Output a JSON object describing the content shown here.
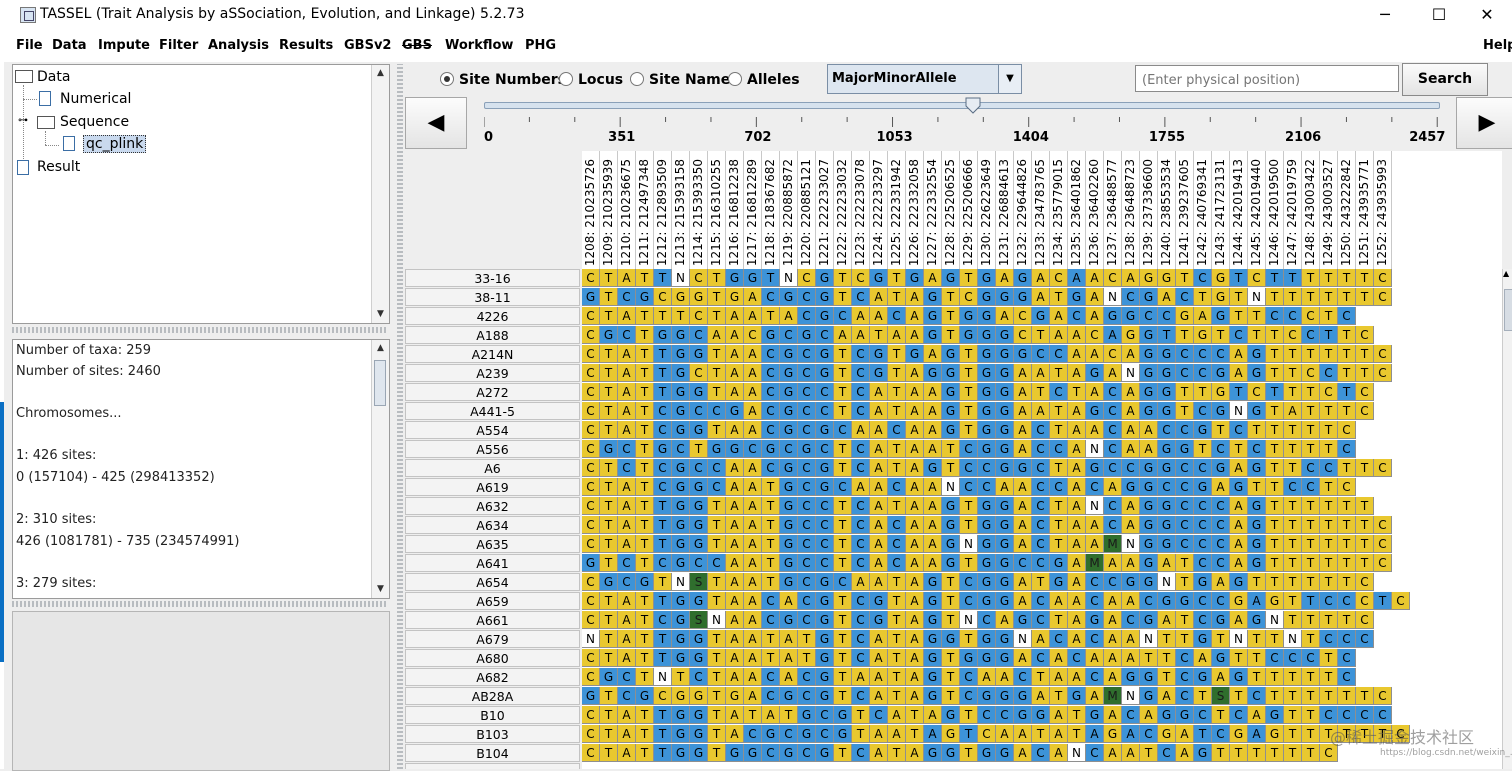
{
  "window": {
    "title": "TASSEL (Trait Analysis by aSSociation, Evolution, and Linkage) 5.2.73",
    "minimize": "─",
    "maximize": "☐",
    "close": "✕"
  },
  "menu": [
    "File",
    "Data",
    "Impute",
    "Filter",
    "Analysis",
    "Results",
    "GBSv2",
    "GBS",
    "Workflow",
    "PHG"
  ],
  "menu_help": "Help",
  "tree": {
    "root": "Data",
    "numerical": "Numerical",
    "sequence": "Sequence",
    "selected": "qc_plink",
    "result": "Result"
  },
  "info_lines": [
    "Number of taxa: 259",
    "Number of sites: 2460",
    "",
    "Chromosomes...",
    "",
    "1: 426 sites:",
    "0 (157104) - 425 (298413352)",
    "",
    "2: 310 sites:",
    "426 (1081781) - 735 (234574991)",
    "",
    "3: 279 sites:"
  ],
  "view_options": {
    "site_numbers": "Site Numbers",
    "locus": "Locus",
    "site_name": "Site Name",
    "alleles": "Alleles",
    "selected": "site_numbers"
  },
  "color_mode": "MajorMinorAllele",
  "search": {
    "placeholder": "(Enter physical position)",
    "button": "Search"
  },
  "nav": {
    "prev": "◀",
    "next": "▶"
  },
  "slider": {
    "ticks": [
      "0",
      "351",
      "702",
      "1053",
      "1404",
      "1755",
      "2106",
      "2457"
    ],
    "position": 1260,
    "max": 2459
  },
  "sites": [
    "1208: 210235726",
    "1209: 210235939",
    "1210: 210236675",
    "1211: 212497348",
    "1212: 212893509",
    "1213: 215393158",
    "1214: 215393350",
    "1215: 216310255",
    "1216: 216812238",
    "1217: 216812289",
    "1218: 218367682",
    "1219: 220885872",
    "1220: 220885121",
    "1221: 222233027",
    "1222: 222233032",
    "1223: 222233078",
    "1224: 222233297",
    "1225: 222331942",
    "1226: 222332058",
    "1227: 222332554",
    "1228: 225206525",
    "1229: 225206666",
    "1230: 226223649",
    "1231: 226884613",
    "1232: 229644826",
    "1233: 234783765",
    "1234: 235779015",
    "1235: 236401862",
    "1236: 236402260",
    "1237: 236488577",
    "1238: 236488723",
    "1239: 237336600",
    "1240: 238553534",
    "1241: 239237605",
    "1242: 240769341",
    "1243: 241723131",
    "1244: 242019413",
    "1245: 242019440",
    "1246: 242019500",
    "1247: 242019759",
    "1248: 243003422",
    "1249: 243003527",
    "1250: 243222842",
    "1251: 243935771",
    "1252: 243935993"
  ],
  "rows": [
    {
      "taxon": "33-16",
      "seq": "CTATTNCTGGTNCGTCGTGAGTGAGACAACAGGTCGTCTTTTTTC",
      "col": "YYYYBWYYBBBWYBYYBYBYBYBYBYYBYYYYYYBYBYBBYYYYY"
    },
    {
      "taxon": "38-11",
      "seq": "GTCGCGGTGACGCGTCATAGTCGGGATGANCGACTGTNTTTTTTC",
      "col": "BYBBYYYYYYBBBBYBYYYBYYBBBYYBYWBBYBYYYWYYYYYYY"
    },
    {
      "taxon": "4226",
      "seq": "CTATTTCTAATACGCAACAGTGGACGACAGGCCGAGTTCCCTC",
      "col": "YYYYYYYYYYYYBBBYYBYBYBBYYBYBYBBBBYYBYYBBYYB"
    },
    {
      "taxon": "A188",
      "seq": "CGCTGGCAACGCGCAATAAGTGGGCTAACAGGTTGTCTTCCTTC",
      "col": "YBBYBBBYYYBBBBYYYYYBYBBBYYYYYBYBBYYYBYYYBBYYY"
    },
    {
      "taxon": "A214N",
      "seq": "CTATTGGTAACGCGTCGTGAGTGGGCCAACAGGCCCAGTTTTTTC",
      "col": "YYYYBBBYYYBBBBYBBYBYBYBBBBBYYYYBBBBBYBYYYYYYY"
    },
    {
      "taxon": "A239",
      "seq": "CTATTGCTAACGCGTCGTAGGTGGAATAGANGGCCGAGTTCCTTC",
      "col": "YYYYBBYYYYBBBBYBBYYBBYBBYYYYBYWBBBBBYBYYYBYYY"
    },
    {
      "taxon": "A272",
      "seq": "CTATTGGTAACGCCTCATAAGTGGATCTACAGGTTGTCTTTCTC",
      "col": "YYYYBBBYYYBBBBYBYYYYBYBBYYBYYBYBBYYYBYBYYYBYY"
    },
    {
      "taxon": "A441-5",
      "seq": "CTATCGCCGACGCCTCATAAGTGGAATAGCAGGTCGNGTATTTC",
      "col": "YYYYBBBBBYBBBBYBYYYYBYBBYYYYBBYBBYBBWBYYYYYYY"
    },
    {
      "taxon": "A554",
      "seq": "CTATCGGTAACGCGCAACAAGTGGACTAACAACCGTCTTTTTC",
      "col": "YYYYBBBYYYBBBBBYYBYYBYBBYBYYYBYYBBBYBYYYYYY"
    },
    {
      "taxon": "A556",
      "seq": "CGCTGCTGGCGCGCTCATAATCGGACCANCAAGGTCTCTTTTC",
      "col": "YBBYBBYBBBBBBBYBYYYYYBBBYBBYWBYYBBYBYBYYYYB"
    },
    {
      "taxon": "A6",
      "seq": "CTCTCGCCAACGCGTCATAGTCCGGCTAGCCGGCCGAGTTCCTTC",
      "col": "YYBYBBBBYYBBBBYBYYYBYBBBBBYYBBBBBBBBYBYYBBYYY"
    },
    {
      "taxon": "A619",
      "seq": "CTATCGGCAATGCGCAACAANCCAACCACAGGCCGAGTTCCTC",
      "col": "YYYYBBBBYYYBBBBYYBYYWBBYYBBYBYBBBBBYBYYBBYY"
    },
    {
      "taxon": "A632",
      "seq": "CTATTGGTAATGCCTCATAAGTGGACTANCAGGCCCAGTTTTTT",
      "col": "YYYYBBBYYYYBBBYBYYYYBYBBYBYYWBYBBBBBYBYYYYYYY"
    },
    {
      "taxon": "A634",
      "seq": "CTATTGGTAATGCCTCACAAGTGGACTAACAGGCCCAGTTTTTTC",
      "col": "YYYYBBBYYYYBBBYBYBYYBYBBYBYYYBYBBBBBYBYYYYYYY"
    },
    {
      "taxon": "A635",
      "seq": "CTATTGGTAATGCCTCACAAGNGGACTAAMNGGCCCAGTTTTTTC",
      "col": "YYYYBBBYYYYBBBYBYBYYBWBBYBYYYGWBBBBBYBYYYYYYY"
    },
    {
      "taxon": "A641",
      "seq": "GTCTCGCCAATGCCTCACAAGTGGCCGAMAAGATCCAGTTTTTTC",
      "col": "BYBYBBBBYYYBBBYBYBYYBYBBBBBYGYYBYYBBYBYYYYYYY"
    },
    {
      "taxon": "A654",
      "seq": "CGCGTNSTAATGCGCAATAGTCGGATGACCGGNTGAGTTTTTTC",
      "col": "YBBBYWGYYYYBBBBYYYYBYBBBYYBYBBBBWYBYBYYYYYYY"
    },
    {
      "taxon": "A659",
      "seq": "CTATTGGTAACACGTCGTAGTCGGACAACAACGGCCGAGTTCCCTC",
      "col": "YYYYBBBYYYBYBBYBBYYBYBBBYBYYBYYBBBBBYBYYBBBYBY"
    },
    {
      "taxon": "A661",
      "seq": "CTATCGSNAACGCGTCGTAGTNCAGCTAGACGATCGAGNTTTTC",
      "col": "YYYYBBGWYYBBBBYBBYYBYWBYBBYYBYBBYYBBYBWYYYYYY"
    },
    {
      "taxon": "A679",
      "seq": "NTATTGGTAATATGTCATAGGTGGNACACAANTTGTNTTNTCCC",
      "col": "WYYYBBBYYYYYYBYBYYYBBYBBWYBYBYYWYYBYWYYWYBBB"
    },
    {
      "taxon": "A680",
      "seq": "CTATTGGTAATATGTCATAGTGGGACACAAATTCAGTTCCCTC",
      "col": "YYYYBBBYYYYYYBYBYYYBYBBBYBYBYYYYYBYBYYBBBYB"
    },
    {
      "taxon": "A682",
      "seq": "CGCTNTCTAACACGTAATAGTCAACTAACAGGTCGAGTTTTTC",
      "col": "YBBYWYBYYYBYBBYYYYYBYBYYBYYYBYBBYBBYBYYYYYB"
    },
    {
      "taxon": "AB28A",
      "seq": "GTCGCGGTGACGCGTCATAGTCGGGATGAMNGACTSTCTTTTTTC",
      "col": "BYBBYYYYYYBBBBYBYYYBYBBBBYYBYGWBYBYGYBYYYYYYY"
    },
    {
      "taxon": "B10",
      "seq": "CTATTGGTATATGCGTCATAGTCCGGATGACAGGCTCAGTTCCCC",
      "col": "YYYYBBBYYYYYBBBYBYYYBYBBBBYYBYBYBBBYBYBYYBBBB"
    },
    {
      "taxon": "B103",
      "seq": "CTATTGGTACGCGCGTAATAGTCAATATAGACGATCGAGTTTTTTC",
      "col": "YYYYBBBYYBBBBBBYYYYBYBYYYYYYBYBBYYBBYBYYYYYYYY"
    },
    {
      "taxon": "B104",
      "seq": "CTATTGGTGGCGCGTCATAGGTGGACANCAATCAGTTTTTTC",
      "col": "YYYYBBBYBBBBBBYBYYYBBYBBYBYWBYYYBYBYYYYYYY"
    }
  ],
  "colors": {
    "yellow": "#e9c82f",
    "blue": "#3d93d8",
    "white": "#ffffff",
    "green": "#2f6e2d"
  },
  "watermark": "@稀土掘金技术社区",
  "watermark_url": "https://blog.csdn.net/weixin_..."
}
